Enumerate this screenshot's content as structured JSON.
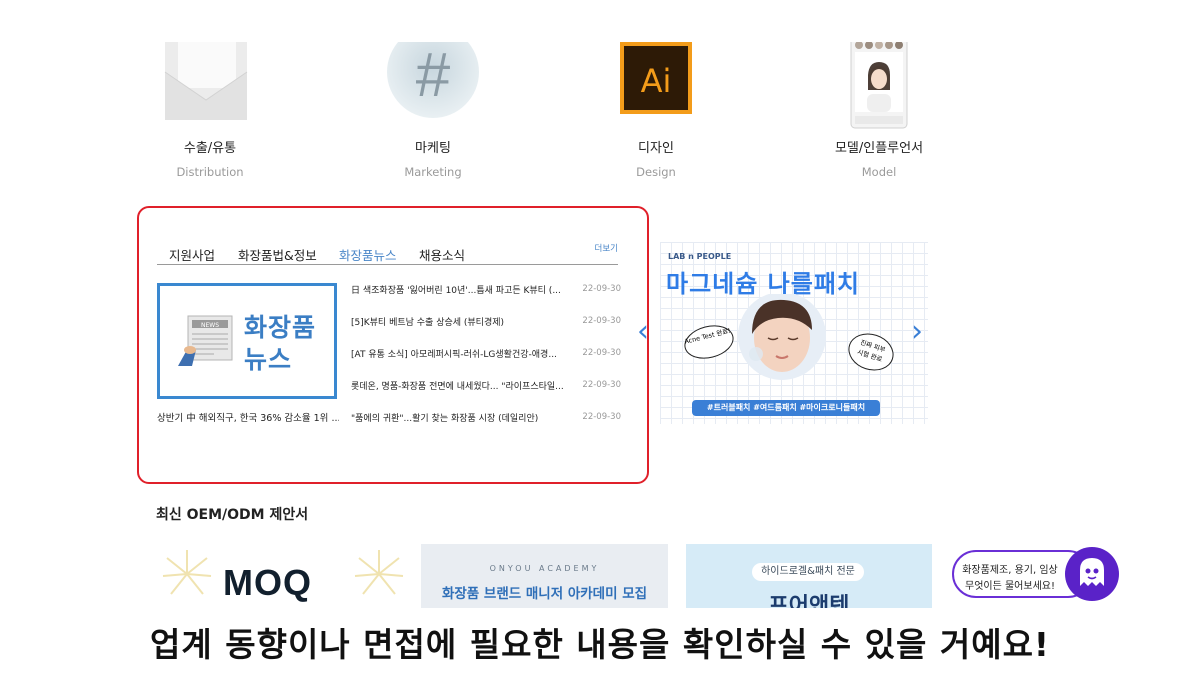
{
  "categories": [
    {
      "kr": "수출/유통",
      "en": "Distribution",
      "icon": "envelope-icon"
    },
    {
      "kr": "마케팅",
      "en": "Marketing",
      "icon": "hashtag-icon"
    },
    {
      "kr": "디자인",
      "en": "Design",
      "icon": "illustrator-icon",
      "icon_text": "Ai"
    },
    {
      "kr": "모델/인플루언서",
      "en": "Model",
      "icon": "phone-profile-icon"
    }
  ],
  "news": {
    "tabs": [
      "지원사업",
      "화장품법&정보",
      "화장품뉴스",
      "채용소식"
    ],
    "active_tab": "화장품뉴스",
    "more": "더보기",
    "image_title_line1": "화장품",
    "image_title_line2": "뉴스",
    "image_badge": "NEWS",
    "caption": "상반기 中 해외직구, 한국 36% 감소율 1위 ......",
    "items": [
      {
        "title": "日 색조화장품 '잃어버린 10년'...틈새 파고든 K뷰티 (...",
        "date": "22-09-30"
      },
      {
        "title": "[5]K뷰티 베트남 수출 상승세 (뷰티경제)",
        "date": "22-09-30"
      },
      {
        "title": "[AT 유통 소식] 아모레퍼시픽-러쉬-LG생활건강-애경...",
        "date": "22-09-30"
      },
      {
        "title": "롯데온, 명품-화장품 전면에 내세웠다... \"라이프스타일...",
        "date": "22-09-30"
      },
      {
        "title": "\"품에의 귀환\"...활기 찾는 화장품 시장 (데일리안)",
        "date": "22-09-30"
      }
    ]
  },
  "banner": {
    "brand": "LAB n PEOPLE",
    "headline": "마그네슘 나를패치",
    "bubble_left": "Acne Test 완료!",
    "bubble_right": "진짜 피부 시험 완료",
    "tags": "#트러블패치 #여드름패치 #마이크로니들패치"
  },
  "section_title": "최신 OEM/ODM 제안서",
  "cards": [
    {
      "label": "MOQ"
    },
    {
      "top": "ONYOU ACADEMY",
      "label": "화장품 브랜드 매니저 아카데미 모집"
    },
    {
      "top": "하이드로겔&패치 전문",
      "label": "프어앤텐"
    }
  ],
  "chat": {
    "line1": "화장품제조, 용기, 임상",
    "line2": "무엇이든 물어보세요!"
  },
  "subtitle": "업계 동향이나 면접에 필요한 내용을 확인하실 수 있을 거예요!",
  "colors": {
    "accent_blue": "#3a88d0",
    "highlight_red": "#e0202a",
    "chat_purple": "#6a2fd6",
    "banner_blue": "#3a7fd6"
  }
}
